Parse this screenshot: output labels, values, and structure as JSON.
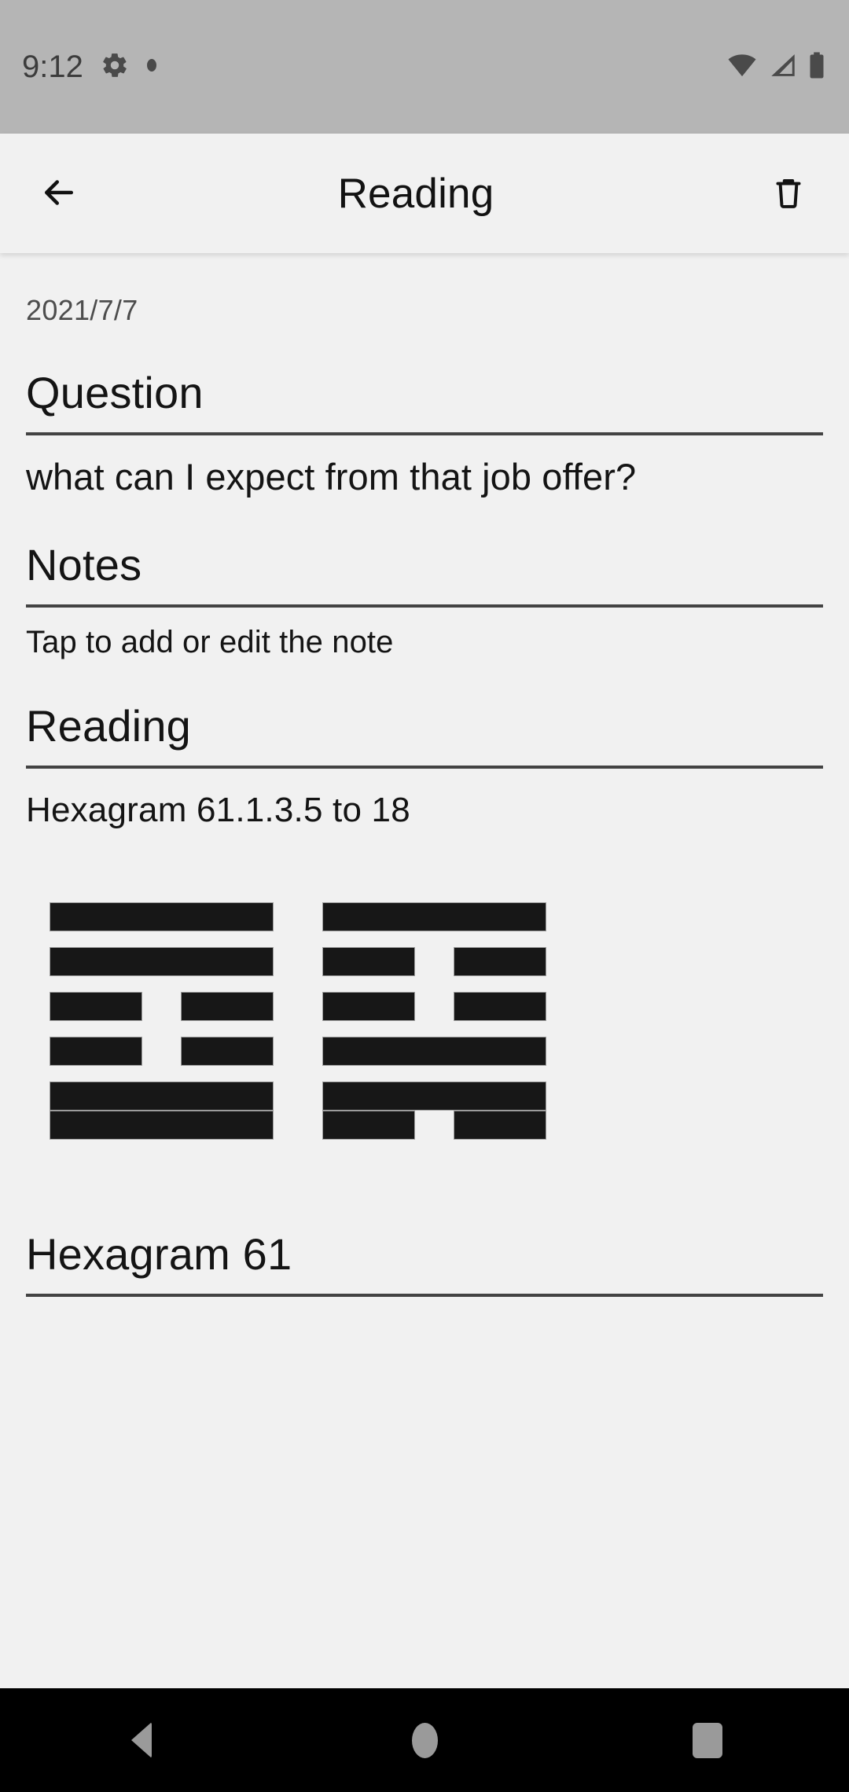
{
  "status_bar": {
    "time": "9:12",
    "icons_left": [
      "gear-icon",
      "dot-icon"
    ],
    "icons_right": [
      "wifi-icon",
      "cellular-signal-icon",
      "battery-icon"
    ],
    "background_color": "#b5b5b5",
    "foreground_color": "#4a4a4a"
  },
  "app_bar": {
    "back_icon": "arrow-back-icon",
    "title": "Reading",
    "delete_icon": "trash-icon",
    "background_color": "#f1f1f1"
  },
  "content": {
    "date": "2021/7/7",
    "question": {
      "heading": "Question",
      "text": "what can I expect from that job offer?"
    },
    "notes": {
      "heading": "Notes",
      "placeholder": "Tap to add or edit the note"
    },
    "reading": {
      "heading": "Reading",
      "label": "Hexagram 61.1.3.5 to 18"
    },
    "hexagram_section": {
      "heading": "Hexagram 61"
    }
  },
  "hexagram_diagram": {
    "primary": {
      "number": 61,
      "name": "Hexagram 61",
      "lines_bottom_to_top": [
        "yang",
        "yang",
        "yin",
        "yin",
        "yang",
        "yang"
      ]
    },
    "transformed": {
      "number": 18,
      "name": "Hexagram 18",
      "lines_bottom_to_top": [
        "yin",
        "yang",
        "yang",
        "yin",
        "yin",
        "yang"
      ]
    },
    "changing_lines": [
      1,
      3,
      5
    ],
    "line_color": "#171717"
  },
  "nav_bar": {
    "back": "nav-back-icon",
    "home": "nav-home-icon",
    "recents": "nav-recents-icon",
    "background_color": "#000000",
    "icon_color": "#9a9a9a"
  }
}
